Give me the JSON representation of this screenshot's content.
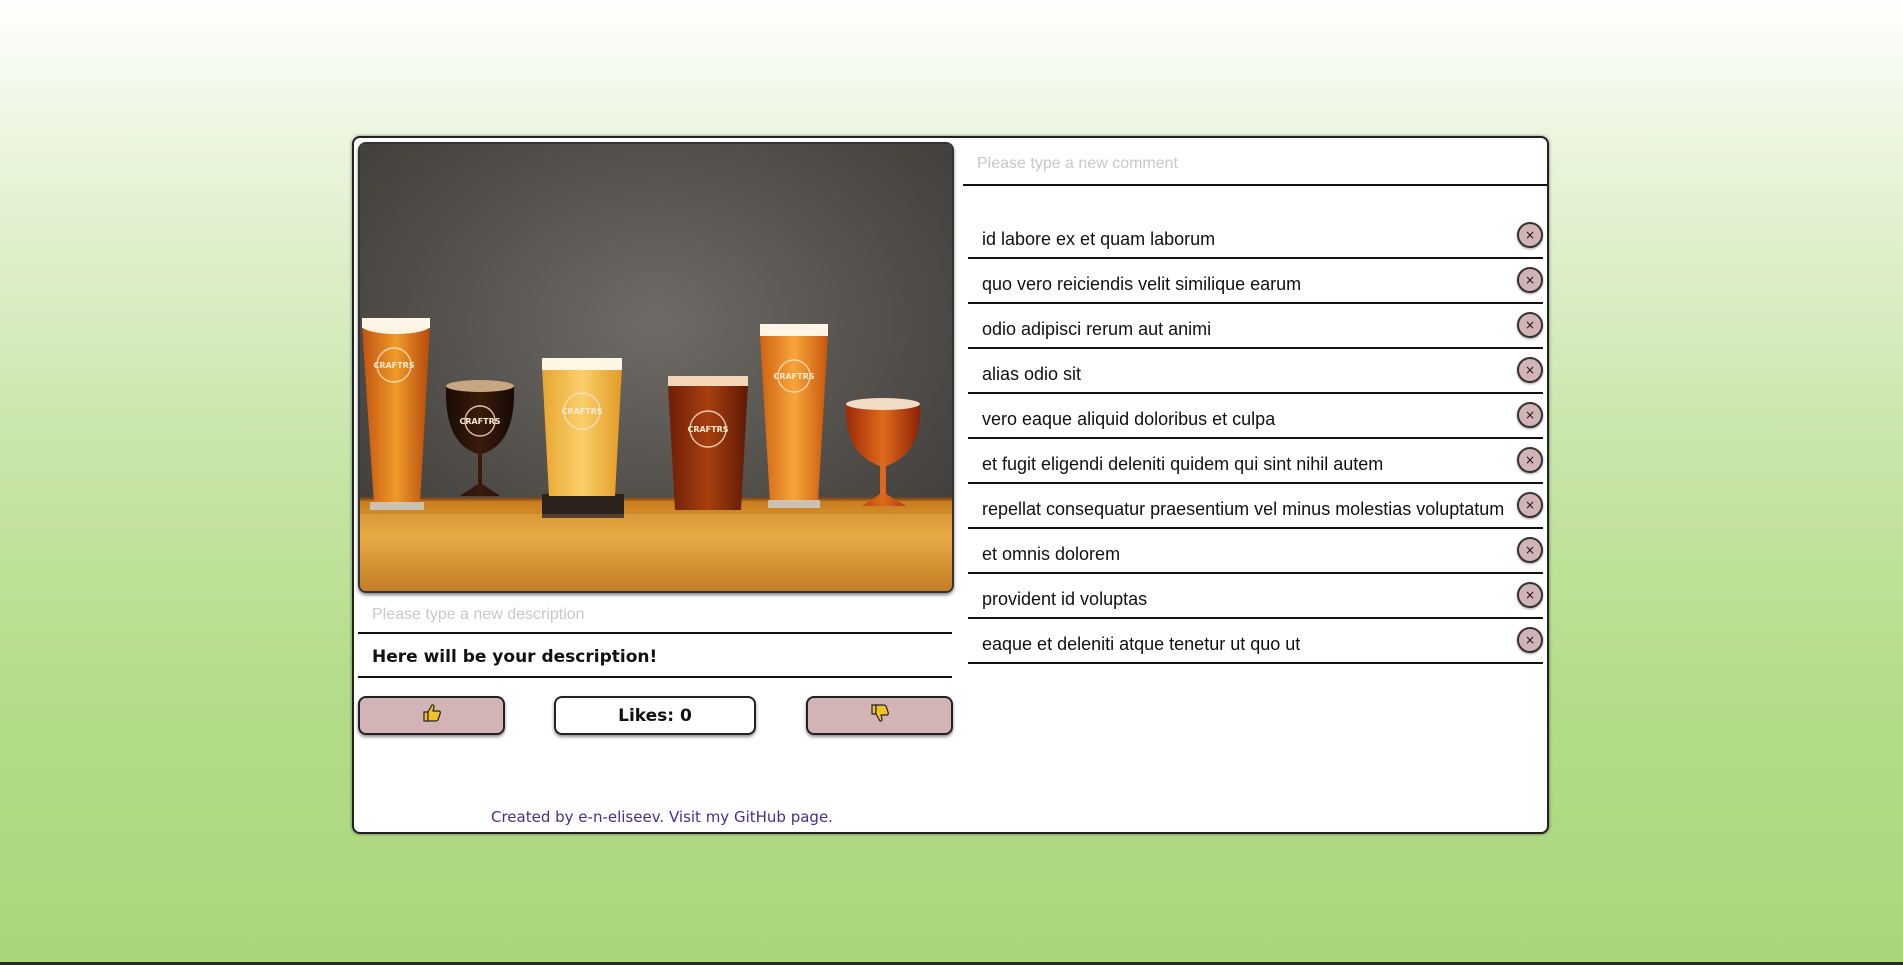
{
  "description": {
    "input_placeholder": "Please type a new description",
    "current": "Here will be your description!"
  },
  "likes": {
    "label": "Likes: 0",
    "like_icon": "thumbs-up-icon",
    "dislike_icon": "thumbs-down-icon"
  },
  "comments": {
    "input_placeholder": "Please type a new comment",
    "delete_glyph": "×",
    "items": [
      {
        "text": "id labore ex et quam laborum"
      },
      {
        "text": "quo vero reiciendis velit similique earum"
      },
      {
        "text": "odio adipisci rerum aut animi"
      },
      {
        "text": "alias odio sit"
      },
      {
        "text": "vero eaque aliquid doloribus et culpa"
      },
      {
        "text": "et fugit eligendi deleniti quidem qui sint nihil autem"
      },
      {
        "text": "repellat consequatur praesentium vel minus molestias voluptatum"
      },
      {
        "text": "et omnis dolorem"
      },
      {
        "text": "provident id voluptas"
      },
      {
        "text": "eaque et deleniti atque tenetur ut quo ut"
      }
    ]
  },
  "footer": {
    "created_by": "Created by e-n-eliseev.",
    "github_link": "Visit my GitHub page."
  },
  "photo": {
    "glass_label": "CRAFTRS"
  },
  "colors": {
    "button_bg": "#d2b4b6",
    "footer_text": "#4a2e86",
    "icon_fill": "#f2c02b"
  }
}
